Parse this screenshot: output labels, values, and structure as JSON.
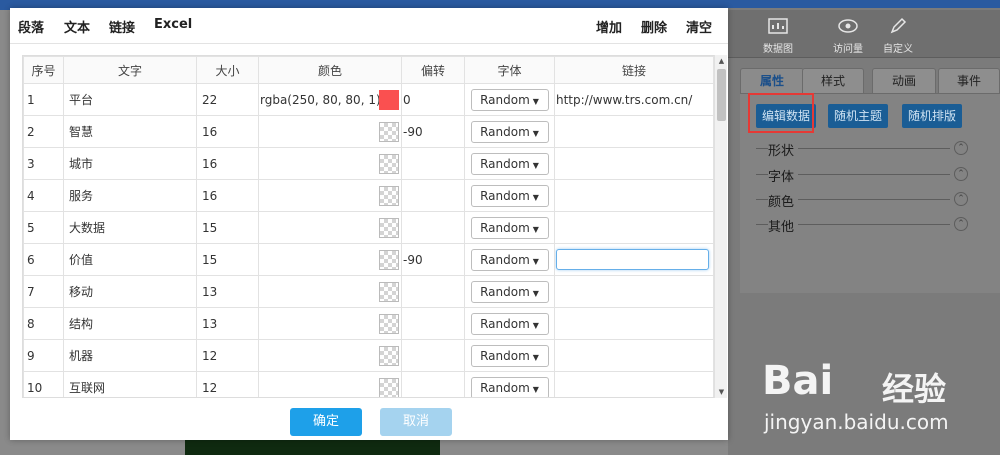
{
  "dialog": {
    "toolbar_left": [
      "段落",
      "文本",
      "链接",
      "Excel"
    ],
    "toolbar_right": [
      "增加",
      "删除",
      "清空"
    ],
    "columns": [
      "序号",
      "文字",
      "大小",
      "颜色",
      "偏转",
      "字体",
      "链接"
    ],
    "rows": [
      {
        "index": "1",
        "text": "平台",
        "size": "22",
        "color_text": "rgba(250, 80, 80, 1)",
        "swatch": "red",
        "rotate": "0",
        "font": "Random",
        "link": "http://www.trs.com.cn/"
      },
      {
        "index": "2",
        "text": "智慧",
        "size": "16",
        "color_text": "",
        "swatch": "transparent",
        "rotate": "-90",
        "font": "Random",
        "link": ""
      },
      {
        "index": "3",
        "text": "城市",
        "size": "16",
        "color_text": "",
        "swatch": "transparent",
        "rotate": "",
        "font": "Random",
        "link": ""
      },
      {
        "index": "4",
        "text": "服务",
        "size": "16",
        "color_text": "",
        "swatch": "transparent",
        "rotate": "",
        "font": "Random",
        "link": ""
      },
      {
        "index": "5",
        "text": "大数据",
        "size": "15",
        "color_text": "",
        "swatch": "transparent",
        "rotate": "",
        "font": "Random",
        "link": ""
      },
      {
        "index": "6",
        "text": "价值",
        "size": "15",
        "color_text": "",
        "swatch": "transparent",
        "rotate": "-90",
        "font": "Random",
        "link": "",
        "link_focused": true
      },
      {
        "index": "7",
        "text": "移动",
        "size": "13",
        "color_text": "",
        "swatch": "transparent",
        "rotate": "",
        "font": "Random",
        "link": ""
      },
      {
        "index": "8",
        "text": "结构",
        "size": "13",
        "color_text": "",
        "swatch": "transparent",
        "rotate": "",
        "font": "Random",
        "link": ""
      },
      {
        "index": "9",
        "text": "机器",
        "size": "12",
        "color_text": "",
        "swatch": "transparent",
        "rotate": "",
        "font": "Random",
        "link": ""
      },
      {
        "index": "10",
        "text": "互联网",
        "size": "12",
        "color_text": "",
        "swatch": "transparent",
        "rotate": "",
        "font": "Random",
        "link": ""
      }
    ],
    "ok_label": "确定",
    "cancel_label": "取消"
  },
  "right_panel": {
    "toolbar": [
      "数据图",
      "访问量",
      "自定义"
    ],
    "tabs": [
      "属性",
      "样式",
      "动画",
      "事件"
    ],
    "buttons": [
      "编辑数据",
      "随机主题",
      "随机排版"
    ],
    "properties": [
      "形状",
      "字体",
      "颜色",
      "其他"
    ]
  },
  "watermark": {
    "logo": "Bai",
    "cn": "经验",
    "url": "jingyan.baidu.com"
  },
  "colors": {
    "primary": "#1ea0e9",
    "swatch_red": "#fa5050",
    "highlight": "#e53935"
  }
}
